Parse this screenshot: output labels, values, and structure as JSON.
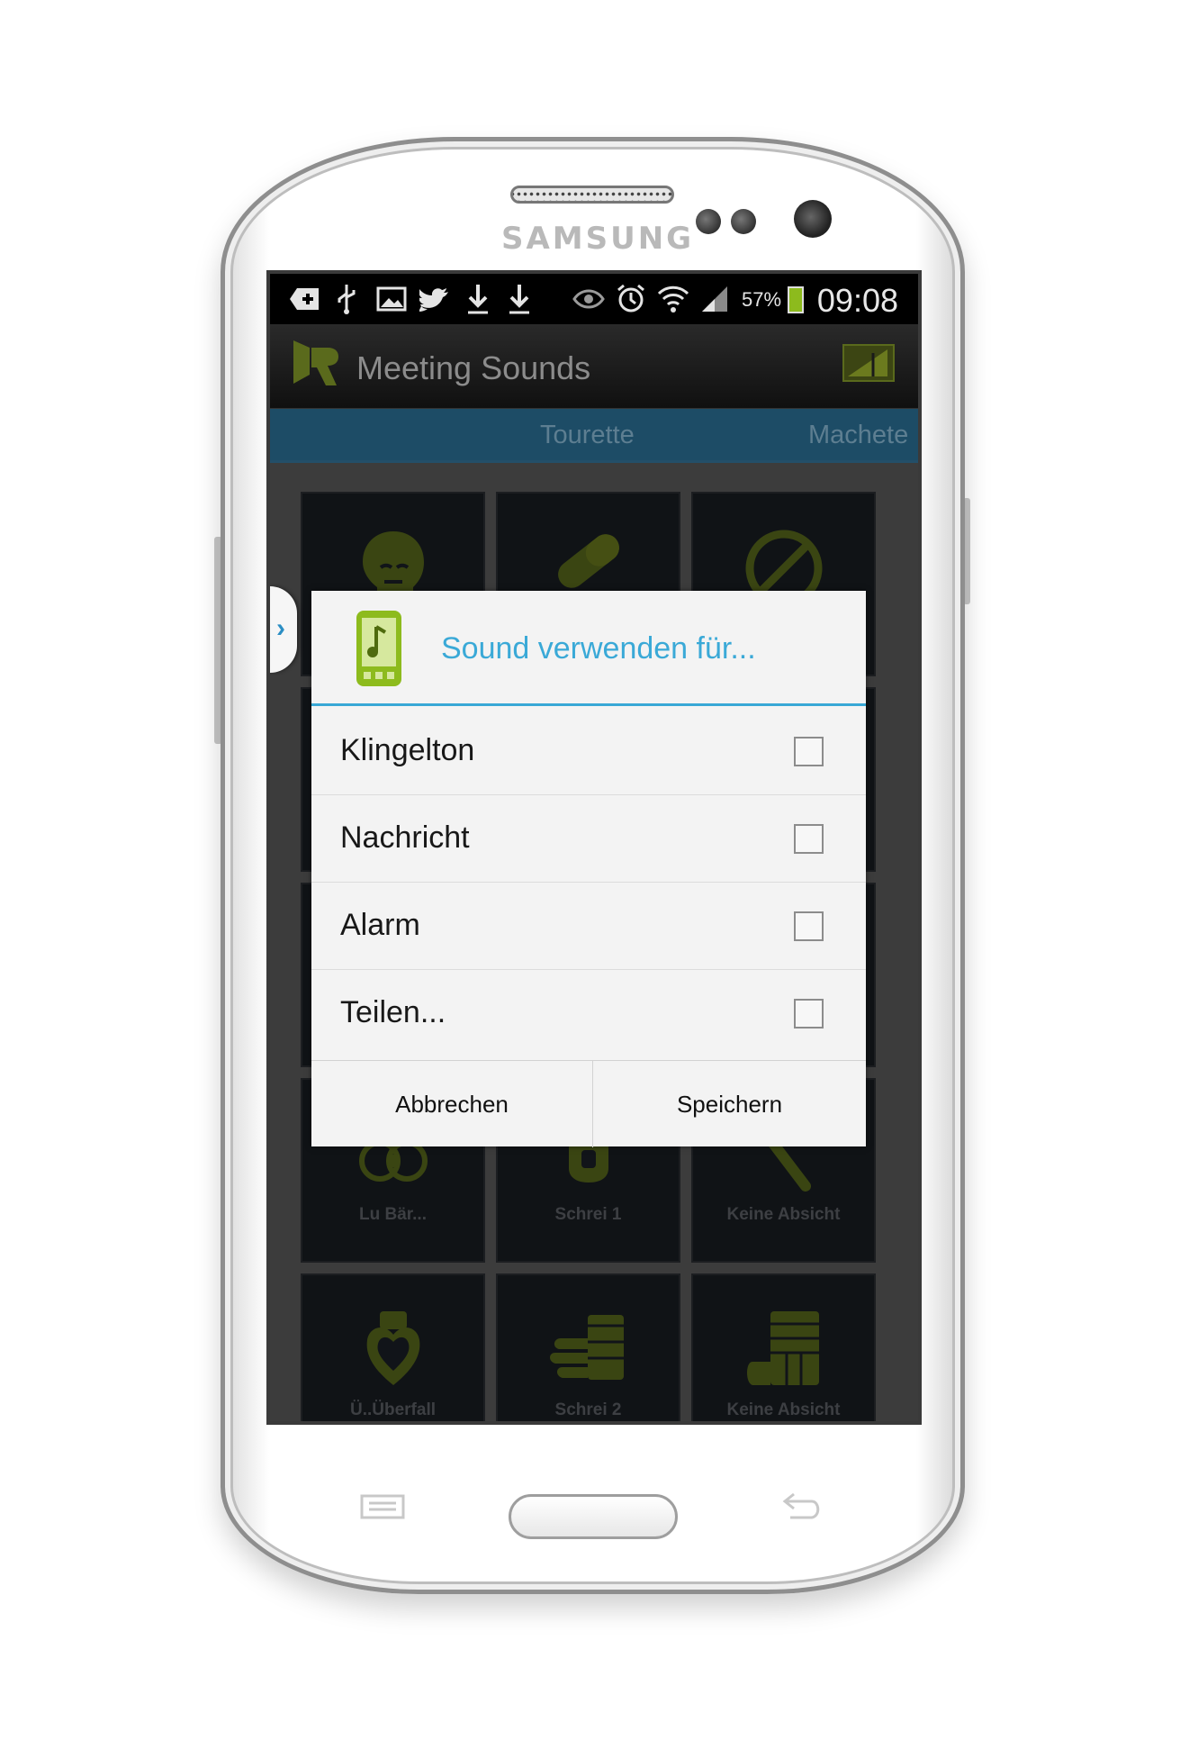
{
  "device": {
    "brand": "SAMSUNG"
  },
  "statusbar": {
    "icons": [
      "notification-plus-icon",
      "usb-icon",
      "image-icon",
      "twitter-icon",
      "download-icon",
      "download-icon",
      "eye-icon",
      "alarm-icon",
      "wifi-icon",
      "signal-icon"
    ],
    "battery_percent": "57%",
    "battery_color": "#8dbb1d",
    "time": "09:08"
  },
  "actionbar": {
    "title": "Meeting Sounds",
    "accent": "#6b7a1e"
  },
  "tabs": [
    {
      "label": "Tourette"
    },
    {
      "label": "Machete"
    }
  ],
  "grid": {
    "tiles": [
      {
        "label": "",
        "icon": "head-puzzle-icon"
      },
      {
        "label": "",
        "icon": "pill-icon"
      },
      {
        "label": "",
        "icon": "forbidden-icon"
      },
      {
        "label": "Lu Bär...",
        "icon": "biohazard-icon"
      },
      {
        "label": "Schrei 1",
        "icon": "blood-bag-icon"
      },
      {
        "label": "Keine Absicht",
        "icon": "bat-icon"
      },
      {
        "label": "Ü..Überfall",
        "icon": "heart-icon"
      },
      {
        "label": "Schrei 2",
        "icon": "bandaged-hand-icon"
      },
      {
        "label": "Keine Absicht",
        "icon": "cast-leg-icon"
      }
    ],
    "icon_color": "#6b7a1e"
  },
  "dialog": {
    "title": "Sound verwenden für...",
    "title_color": "#3aa9d7",
    "options": [
      {
        "label": "Klingelton",
        "checked": false
      },
      {
        "label": "Nachricht",
        "checked": false
      },
      {
        "label": "Alarm",
        "checked": false
      },
      {
        "label": "Teilen...",
        "checked": false
      }
    ],
    "cancel_label": "Abbrechen",
    "save_label": "Speichern"
  }
}
